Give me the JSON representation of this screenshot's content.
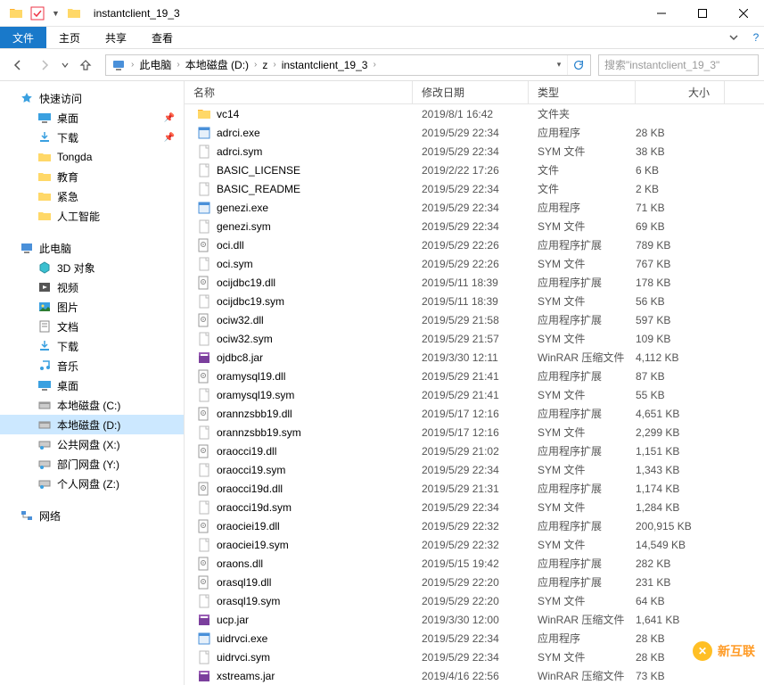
{
  "window": {
    "title": "instantclient_19_3"
  },
  "ribbon": {
    "file": "文件",
    "home": "主页",
    "share": "共享",
    "view": "查看"
  },
  "breadcrumb": {
    "items": [
      "此电脑",
      "本地磁盘 (D:)",
      "z",
      "instantclient_19_3"
    ]
  },
  "search": {
    "placeholder": "搜索\"instantclient_19_3\""
  },
  "sidebar": {
    "quick": {
      "label": "快速访问",
      "items": [
        {
          "label": "桌面",
          "pin": true,
          "icon": "desktop"
        },
        {
          "label": "下载",
          "pin": true,
          "icon": "downloads"
        },
        {
          "label": "Tongda",
          "pin": false,
          "icon": "folder"
        },
        {
          "label": "教育",
          "pin": false,
          "icon": "folder"
        },
        {
          "label": "紧急",
          "pin": false,
          "icon": "folder"
        },
        {
          "label": "人工智能",
          "pin": false,
          "icon": "folder"
        }
      ]
    },
    "thispc": {
      "label": "此电脑",
      "items": [
        {
          "label": "3D 对象",
          "icon": "3d"
        },
        {
          "label": "视频",
          "icon": "video"
        },
        {
          "label": "图片",
          "icon": "pictures"
        },
        {
          "label": "文档",
          "icon": "docs"
        },
        {
          "label": "下载",
          "icon": "downloads"
        },
        {
          "label": "音乐",
          "icon": "music"
        },
        {
          "label": "桌面",
          "icon": "desktop"
        },
        {
          "label": "本地磁盘 (C:)",
          "icon": "drive"
        },
        {
          "label": "本地磁盘 (D:)",
          "icon": "drive",
          "selected": true
        },
        {
          "label": "公共网盘 (X:)",
          "icon": "netdrive"
        },
        {
          "label": "部门网盘 (Y:)",
          "icon": "netdrive"
        },
        {
          "label": "个人网盘 (Z:)",
          "icon": "netdrive"
        }
      ]
    },
    "network": {
      "label": "网络"
    }
  },
  "columns": {
    "name": "名称",
    "date": "修改日期",
    "type": "类型",
    "size": "大小"
  },
  "files": [
    {
      "name": "vc14",
      "date": "2019/8/1 16:42",
      "type": "文件夹",
      "size": "",
      "icon": "folder"
    },
    {
      "name": "adrci.exe",
      "date": "2019/5/29 22:34",
      "type": "应用程序",
      "size": "28 KB",
      "icon": "exe"
    },
    {
      "name": "adrci.sym",
      "date": "2019/5/29 22:34",
      "type": "SYM 文件",
      "size": "38 KB",
      "icon": "file"
    },
    {
      "name": "BASIC_LICENSE",
      "date": "2019/2/22 17:26",
      "type": "文件",
      "size": "6 KB",
      "icon": "file"
    },
    {
      "name": "BASIC_README",
      "date": "2019/5/29 22:34",
      "type": "文件",
      "size": "2 KB",
      "icon": "file"
    },
    {
      "name": "genezi.exe",
      "date": "2019/5/29 22:34",
      "type": "应用程序",
      "size": "71 KB",
      "icon": "exe"
    },
    {
      "name": "genezi.sym",
      "date": "2019/5/29 22:34",
      "type": "SYM 文件",
      "size": "69 KB",
      "icon": "file"
    },
    {
      "name": "oci.dll",
      "date": "2019/5/29 22:26",
      "type": "应用程序扩展",
      "size": "789 KB",
      "icon": "dll"
    },
    {
      "name": "oci.sym",
      "date": "2019/5/29 22:26",
      "type": "SYM 文件",
      "size": "767 KB",
      "icon": "file"
    },
    {
      "name": "ocijdbc19.dll",
      "date": "2019/5/11 18:39",
      "type": "应用程序扩展",
      "size": "178 KB",
      "icon": "dll"
    },
    {
      "name": "ocijdbc19.sym",
      "date": "2019/5/11 18:39",
      "type": "SYM 文件",
      "size": "56 KB",
      "icon": "file"
    },
    {
      "name": "ociw32.dll",
      "date": "2019/5/29 21:58",
      "type": "应用程序扩展",
      "size": "597 KB",
      "icon": "dll"
    },
    {
      "name": "ociw32.sym",
      "date": "2019/5/29 21:57",
      "type": "SYM 文件",
      "size": "109 KB",
      "icon": "file"
    },
    {
      "name": "ojdbc8.jar",
      "date": "2019/3/30 12:11",
      "type": "WinRAR 压缩文件",
      "size": "4,112 KB",
      "icon": "rar"
    },
    {
      "name": "oramysql19.dll",
      "date": "2019/5/29 21:41",
      "type": "应用程序扩展",
      "size": "87 KB",
      "icon": "dll"
    },
    {
      "name": "oramysql19.sym",
      "date": "2019/5/29 21:41",
      "type": "SYM 文件",
      "size": "55 KB",
      "icon": "file"
    },
    {
      "name": "orannzsbb19.dll",
      "date": "2019/5/17 12:16",
      "type": "应用程序扩展",
      "size": "4,651 KB",
      "icon": "dll"
    },
    {
      "name": "orannzsbb19.sym",
      "date": "2019/5/17 12:16",
      "type": "SYM 文件",
      "size": "2,299 KB",
      "icon": "file"
    },
    {
      "name": "oraocci19.dll",
      "date": "2019/5/29 21:02",
      "type": "应用程序扩展",
      "size": "1,151 KB",
      "icon": "dll"
    },
    {
      "name": "oraocci19.sym",
      "date": "2019/5/29 22:34",
      "type": "SYM 文件",
      "size": "1,343 KB",
      "icon": "file"
    },
    {
      "name": "oraocci19d.dll",
      "date": "2019/5/29 21:31",
      "type": "应用程序扩展",
      "size": "1,174 KB",
      "icon": "dll"
    },
    {
      "name": "oraocci19d.sym",
      "date": "2019/5/29 22:34",
      "type": "SYM 文件",
      "size": "1,284 KB",
      "icon": "file"
    },
    {
      "name": "oraociei19.dll",
      "date": "2019/5/29 22:32",
      "type": "应用程序扩展",
      "size": "200,915 KB",
      "icon": "dll"
    },
    {
      "name": "oraociei19.sym",
      "date": "2019/5/29 22:32",
      "type": "SYM 文件",
      "size": "14,549 KB",
      "icon": "file"
    },
    {
      "name": "oraons.dll",
      "date": "2019/5/15 19:42",
      "type": "应用程序扩展",
      "size": "282 KB",
      "icon": "dll"
    },
    {
      "name": "orasql19.dll",
      "date": "2019/5/29 22:20",
      "type": "应用程序扩展",
      "size": "231 KB",
      "icon": "dll"
    },
    {
      "name": "orasql19.sym",
      "date": "2019/5/29 22:20",
      "type": "SYM 文件",
      "size": "64 KB",
      "icon": "file"
    },
    {
      "name": "ucp.jar",
      "date": "2019/3/30 12:00",
      "type": "WinRAR 压缩文件",
      "size": "1,641 KB",
      "icon": "rar"
    },
    {
      "name": "uidrvci.exe",
      "date": "2019/5/29 22:34",
      "type": "应用程序",
      "size": "28 KB",
      "icon": "exe"
    },
    {
      "name": "uidrvci.sym",
      "date": "2019/5/29 22:34",
      "type": "SYM 文件",
      "size": "28 KB",
      "icon": "file"
    },
    {
      "name": "xstreams.jar",
      "date": "2019/4/16 22:56",
      "type": "WinRAR 压缩文件",
      "size": "73 KB",
      "icon": "rar"
    }
  ],
  "watermark": "新互联"
}
